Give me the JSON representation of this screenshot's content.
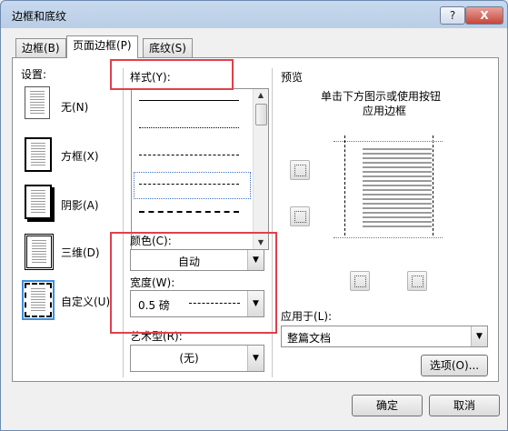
{
  "window": {
    "title": "边框和底纹",
    "help_label": "?",
    "close_label": "X"
  },
  "tabs": [
    {
      "label": "边框(B)",
      "active": false
    },
    {
      "label": "页面边框(P)",
      "active": true
    },
    {
      "label": "底纹(S)",
      "active": false
    }
  ],
  "settings": {
    "heading": "设置:",
    "items": [
      {
        "label": "无(N)",
        "icon": "none-setting-icon"
      },
      {
        "label": "方框(X)",
        "icon": "box-setting-icon"
      },
      {
        "label": "阴影(A)",
        "icon": "shadow-setting-icon"
      },
      {
        "label": "三维(D)",
        "icon": "3d-setting-icon"
      },
      {
        "label": "自定义(U)",
        "icon": "custom-setting-icon",
        "selected": true
      }
    ]
  },
  "style": {
    "label": "样式(Y):"
  },
  "color": {
    "label": "颜色(C):",
    "value": "自动"
  },
  "width": {
    "label": "宽度(W):",
    "value": "0.5 磅"
  },
  "art": {
    "label": "艺术型(R):",
    "value": "(无)"
  },
  "preview": {
    "heading": "预览",
    "hint_line1": "单击下方图示或使用按钮",
    "hint_line2": "应用边框"
  },
  "apply_to": {
    "label": "应用于(L):",
    "value": "整篇文档"
  },
  "options_label": "选项(O)...",
  "ok_label": "确定",
  "cancel_label": "取消",
  "colors": {
    "highlight": "#e0404a",
    "selection": "#3b8ee0"
  }
}
